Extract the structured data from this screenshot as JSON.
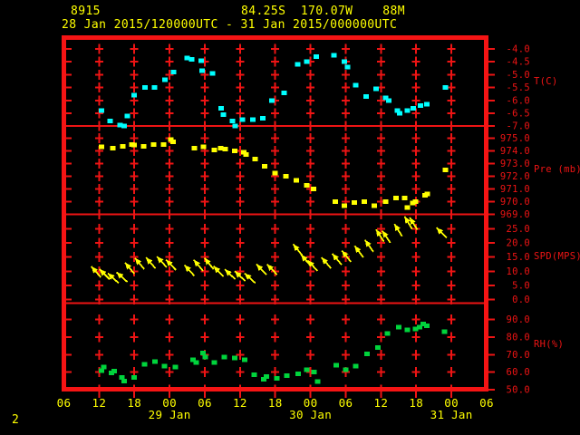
{
  "header": {
    "station_id": "8915",
    "location": "84.25S  170.07W    88M",
    "period": "28 Jan 2015/120000UTC - 31 Jan 2015/000000UTC"
  },
  "footer": {
    "page_number": "2"
  },
  "colors": {
    "background": "#000000",
    "grid_red": "#ee1414",
    "frame_red": "#f51414",
    "header_yellow": "#ffff00",
    "temp_cyan": "#00ffff",
    "pressure_yellow": "#ffff00",
    "wind_yellow": "#ffff00",
    "rh_green": "#00d43c",
    "axis_label_red": "#ee1414",
    "time_label_yellow": "#ffff00"
  },
  "chart_data": {
    "type": "meteogram",
    "title": "Station 8915 meteogram",
    "x_axis": {
      "start": "28 Jan 2015 06:00 UTC",
      "end": "31 Jan 2015 06:00 UTC",
      "hours_span": 72,
      "tick_interval_hours": 6,
      "tick_labels": [
        "06",
        "12",
        "18",
        "00",
        "06",
        "12",
        "18",
        "00",
        "06",
        "12",
        "18",
        "00",
        "06"
      ],
      "date_labels": [
        {
          "label": "29 Jan",
          "hour": 18
        },
        {
          "label": "30 Jan",
          "hour": 42
        },
        {
          "label": "31 Jan",
          "hour": 66
        }
      ]
    },
    "panels": [
      {
        "type": "scatter",
        "name": "temperature",
        "ylabel": "T(C)",
        "yticks": [
          "-4.0",
          "-4.5",
          "-5.0",
          "-5.5",
          "-6.0",
          "-6.5",
          "-7.0"
        ],
        "ytick_values": [
          -4.0,
          -4.5,
          -5.0,
          -5.5,
          -6.0,
          -6.5,
          -7.0
        ],
        "points": [
          [
            6.4,
            -6.4
          ],
          [
            7.9,
            -6.8
          ],
          [
            9.6,
            -6.95
          ],
          [
            10.3,
            -7.0
          ],
          [
            10.8,
            -6.6
          ],
          [
            12.0,
            -5.8
          ],
          [
            13.8,
            -5.5
          ],
          [
            15.4,
            -5.5
          ],
          [
            17.2,
            -5.2
          ],
          [
            18.7,
            -4.9
          ],
          [
            21.0,
            -4.35
          ],
          [
            21.8,
            -4.4
          ],
          [
            23.4,
            -4.45
          ],
          [
            23.5,
            -4.85
          ],
          [
            25.3,
            -4.95
          ],
          [
            26.8,
            -6.3
          ],
          [
            27.2,
            -6.55
          ],
          [
            28.7,
            -6.8
          ],
          [
            29.2,
            -7.0
          ],
          [
            30.4,
            -6.75
          ],
          [
            32.2,
            -6.75
          ],
          [
            33.9,
            -6.7
          ],
          [
            35.4,
            -6.0
          ],
          [
            37.5,
            -5.7
          ],
          [
            39.8,
            -4.6
          ],
          [
            41.4,
            -4.5
          ],
          [
            43.0,
            -4.3
          ],
          [
            46.0,
            -4.25
          ],
          [
            47.8,
            -4.5
          ],
          [
            48.3,
            -4.7
          ],
          [
            49.7,
            -5.4
          ],
          [
            51.5,
            -5.85
          ],
          [
            53.2,
            -5.55
          ],
          [
            54.8,
            -5.9
          ],
          [
            55.3,
            -6.0
          ],
          [
            56.8,
            -6.4
          ],
          [
            57.2,
            -6.5
          ],
          [
            58.5,
            -6.4
          ],
          [
            59.5,
            -6.3
          ],
          [
            60.7,
            -6.2
          ],
          [
            61.8,
            -6.15
          ],
          [
            65.0,
            -5.5
          ]
        ]
      },
      {
        "type": "scatter",
        "name": "pressure",
        "ylabel": "Pre (mb)",
        "yticks": [
          "975.0",
          "974.0",
          "973.0",
          "972.0",
          "971.0",
          "970.0",
          "969.0"
        ],
        "ytick_values": [
          975,
          974,
          973,
          972,
          971,
          970,
          969
        ],
        "points": [
          [
            6.4,
            974.3
          ],
          [
            8.3,
            974.2
          ],
          [
            10.0,
            974.35
          ],
          [
            11.6,
            974.5
          ],
          [
            12.0,
            974.45
          ],
          [
            13.6,
            974.35
          ],
          [
            15.3,
            974.5
          ],
          [
            17.0,
            974.5
          ],
          [
            18.2,
            974.9
          ],
          [
            18.6,
            974.7
          ],
          [
            22.2,
            974.2
          ],
          [
            23.8,
            974.3
          ],
          [
            25.6,
            974.05
          ],
          [
            26.7,
            974.2
          ],
          [
            27.5,
            974.15
          ],
          [
            29.1,
            974.0
          ],
          [
            30.6,
            973.9
          ],
          [
            31.0,
            973.7
          ],
          [
            32.6,
            973.35
          ],
          [
            34.2,
            972.8
          ],
          [
            36.0,
            972.25
          ],
          [
            37.8,
            972.0
          ],
          [
            39.6,
            971.7
          ],
          [
            41.4,
            971.3
          ],
          [
            42.5,
            971.0
          ],
          [
            46.2,
            970.0
          ],
          [
            47.8,
            969.7
          ],
          [
            49.5,
            969.95
          ],
          [
            51.2,
            970.0
          ],
          [
            52.9,
            969.7
          ],
          [
            54.8,
            970.0
          ],
          [
            56.6,
            970.3
          ],
          [
            58.0,
            970.3
          ],
          [
            58.5,
            969.55
          ],
          [
            59.4,
            969.9
          ],
          [
            59.9,
            970.0
          ],
          [
            61.5,
            970.5
          ],
          [
            61.9,
            970.6
          ],
          [
            65.0,
            972.5
          ]
        ]
      },
      {
        "type": "wind-vector",
        "name": "wind_speed",
        "ylabel": "SPD(MPS)",
        "yticks": [
          "25.0",
          "20.0",
          "15.0",
          "10.0",
          "5.0",
          "0.0"
        ],
        "ytick_values": [
          25,
          20,
          15,
          10,
          5,
          0
        ],
        "note": "points are [hour, speed_mps, screen_angle_deg]; arrow tail anchored at value, pointing up-left",
        "points": [
          [
            6.3,
            7.8,
            131
          ],
          [
            7.8,
            7.1,
            135
          ],
          [
            9.3,
            5.8,
            137
          ],
          [
            10.8,
            6.2,
            138
          ],
          [
            12.0,
            9.1,
            130
          ],
          [
            13.7,
            10.7,
            130
          ],
          [
            15.6,
            11.0,
            131
          ],
          [
            17.5,
            11.4,
            132
          ],
          [
            19.1,
            10.4,
            134
          ],
          [
            22.2,
            8.4,
            132
          ],
          [
            23.7,
            10.1,
            130
          ],
          [
            25.5,
            10.7,
            129
          ],
          [
            27.2,
            8.1,
            134
          ],
          [
            29.2,
            7.1,
            136
          ],
          [
            30.9,
            6.5,
            137
          ],
          [
            32.6,
            5.8,
            138
          ],
          [
            34.5,
            8.8,
            134
          ],
          [
            36.3,
            8.8,
            134
          ],
          [
            40.6,
            15.6,
            129
          ],
          [
            42.0,
            12.0,
            131
          ],
          [
            43.2,
            10.1,
            133
          ],
          [
            45.5,
            11.0,
            131
          ],
          [
            47.3,
            12.3,
            130
          ],
          [
            48.9,
            13.3,
            129
          ],
          [
            51.0,
            14.9,
            127
          ],
          [
            52.7,
            16.9,
            125
          ],
          [
            54.5,
            20.5,
            123
          ],
          [
            55.6,
            20.1,
            124
          ],
          [
            57.6,
            22.4,
            122
          ],
          [
            59.3,
            25.0,
            121
          ],
          [
            60.2,
            24.7,
            122
          ],
          [
            65.2,
            21.8,
            135
          ]
        ]
      },
      {
        "type": "scatter",
        "name": "relative_humidity",
        "ylabel": "RH(%)",
        "yticks": [
          "90.0",
          "80.0",
          "70.0",
          "60.0",
          "50.0"
        ],
        "ytick_values": [
          90,
          80,
          70,
          60,
          50
        ],
        "points": [
          [
            6.4,
            61
          ],
          [
            6.8,
            63
          ],
          [
            8.1,
            59.5
          ],
          [
            8.6,
            60.5
          ],
          [
            9.9,
            57
          ],
          [
            10.3,
            55
          ],
          [
            12.0,
            57
          ],
          [
            13.7,
            64.5
          ],
          [
            15.5,
            66
          ],
          [
            17.1,
            63.5
          ],
          [
            19.0,
            63
          ],
          [
            22.0,
            67
          ],
          [
            22.5,
            65.5
          ],
          [
            23.7,
            71
          ],
          [
            24.1,
            68.5
          ],
          [
            25.6,
            65.5
          ],
          [
            27.3,
            68.5
          ],
          [
            29.1,
            68
          ],
          [
            30.8,
            67
          ],
          [
            32.4,
            58.5
          ],
          [
            34.0,
            56
          ],
          [
            34.5,
            57.5
          ],
          [
            36.3,
            56.5
          ],
          [
            38.0,
            58
          ],
          [
            39.9,
            59
          ],
          [
            41.4,
            61.5
          ],
          [
            42.6,
            60
          ],
          [
            43.2,
            54.7
          ],
          [
            46.4,
            64
          ],
          [
            48.0,
            61.5
          ],
          [
            49.7,
            63.5
          ],
          [
            51.6,
            70.5
          ],
          [
            53.5,
            74
          ],
          [
            55.1,
            82
          ],
          [
            57.0,
            85.5
          ],
          [
            58.5,
            84
          ],
          [
            59.9,
            84.5
          ],
          [
            60.6,
            85.5
          ],
          [
            61.2,
            87.5
          ],
          [
            61.8,
            86.5
          ],
          [
            64.8,
            83
          ]
        ]
      }
    ]
  }
}
